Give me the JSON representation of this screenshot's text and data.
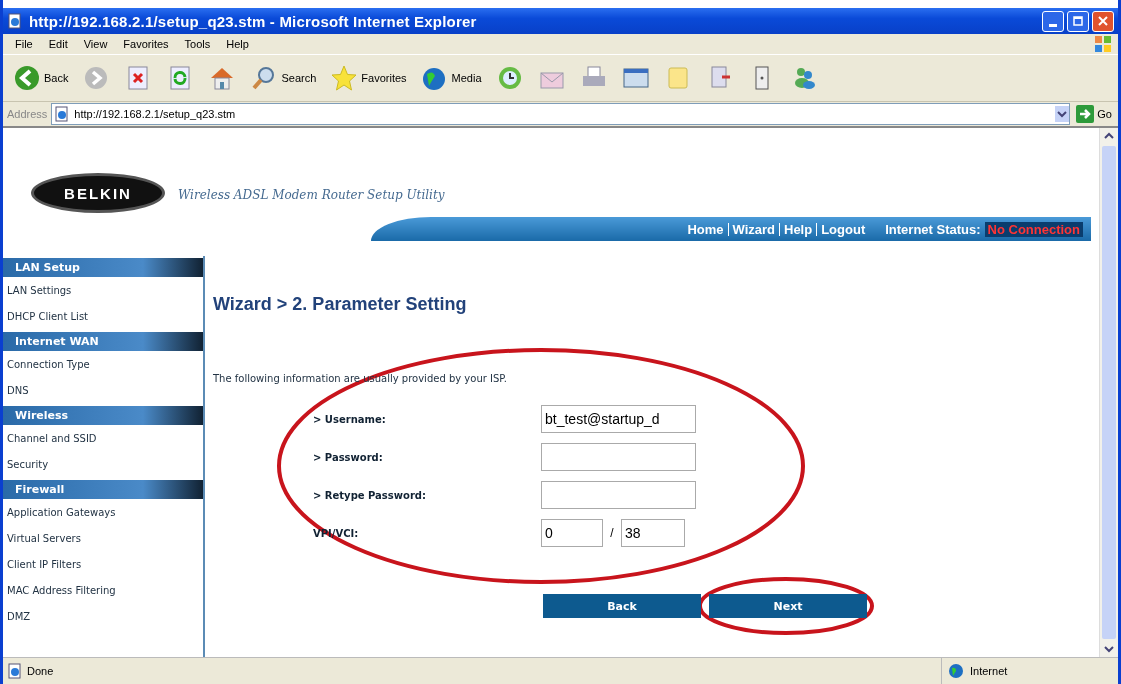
{
  "window": {
    "title": "http://192.168.2.1/setup_q23.stm - Microsoft Internet Explorer"
  },
  "menu": [
    "File",
    "Edit",
    "View",
    "Favorites",
    "Tools",
    "Help"
  ],
  "toolbar": [
    {
      "kind": "back",
      "label": "Back"
    },
    {
      "kind": "forward"
    },
    {
      "kind": "stop"
    },
    {
      "kind": "refresh"
    },
    {
      "kind": "home"
    },
    {
      "kind": "search",
      "label": "Search"
    },
    {
      "kind": "favorites",
      "label": "Favorites"
    },
    {
      "kind": "media",
      "label": "Media"
    },
    {
      "kind": "history"
    },
    {
      "kind": "mail"
    },
    {
      "kind": "print"
    },
    {
      "kind": "edit"
    },
    {
      "kind": "note"
    },
    {
      "kind": "discuss"
    },
    {
      "kind": "device"
    },
    {
      "kind": "messenger"
    }
  ],
  "address": {
    "label": "Address",
    "value": "http://192.168.2.1/setup_q23.stm",
    "go": "Go"
  },
  "page": {
    "logo": "BELKIN",
    "tagline": "Wireless ADSL Modem Router Setup Utility",
    "nav": [
      "Home",
      "Wizard",
      "Help",
      "Logout"
    ],
    "status_label": "Internet Status:",
    "status_value": "No Connection",
    "sidebar": [
      {
        "title": "LAN Setup",
        "items": [
          "LAN Settings",
          "DHCP Client List"
        ]
      },
      {
        "title": "Internet WAN",
        "items": [
          "Connection Type",
          "DNS"
        ]
      },
      {
        "title": "Wireless",
        "items": [
          "Channel and SSID",
          "Security"
        ]
      },
      {
        "title": "Firewall",
        "items": [
          "Application Gateways",
          "Virtual Servers",
          "Client IP Filters",
          "MAC Address Filtering",
          "DMZ"
        ]
      }
    ],
    "heading": "Wizard > 2. Parameter Setting",
    "intro": "The following information are usually provided by your ISP.",
    "fields": [
      {
        "label": "> Username:",
        "value": "bt_test@startup_d"
      },
      {
        "label": "> Password:"
      },
      {
        "label": "> Retype Password:"
      }
    ],
    "vpi_vci": {
      "label": "VPI/VCI:",
      "vpi": "0",
      "separator": "/",
      "vci": "38"
    },
    "buttons": [
      "Back",
      "Next"
    ]
  },
  "status_bar": {
    "text": "Done",
    "zone": "Internet"
  }
}
